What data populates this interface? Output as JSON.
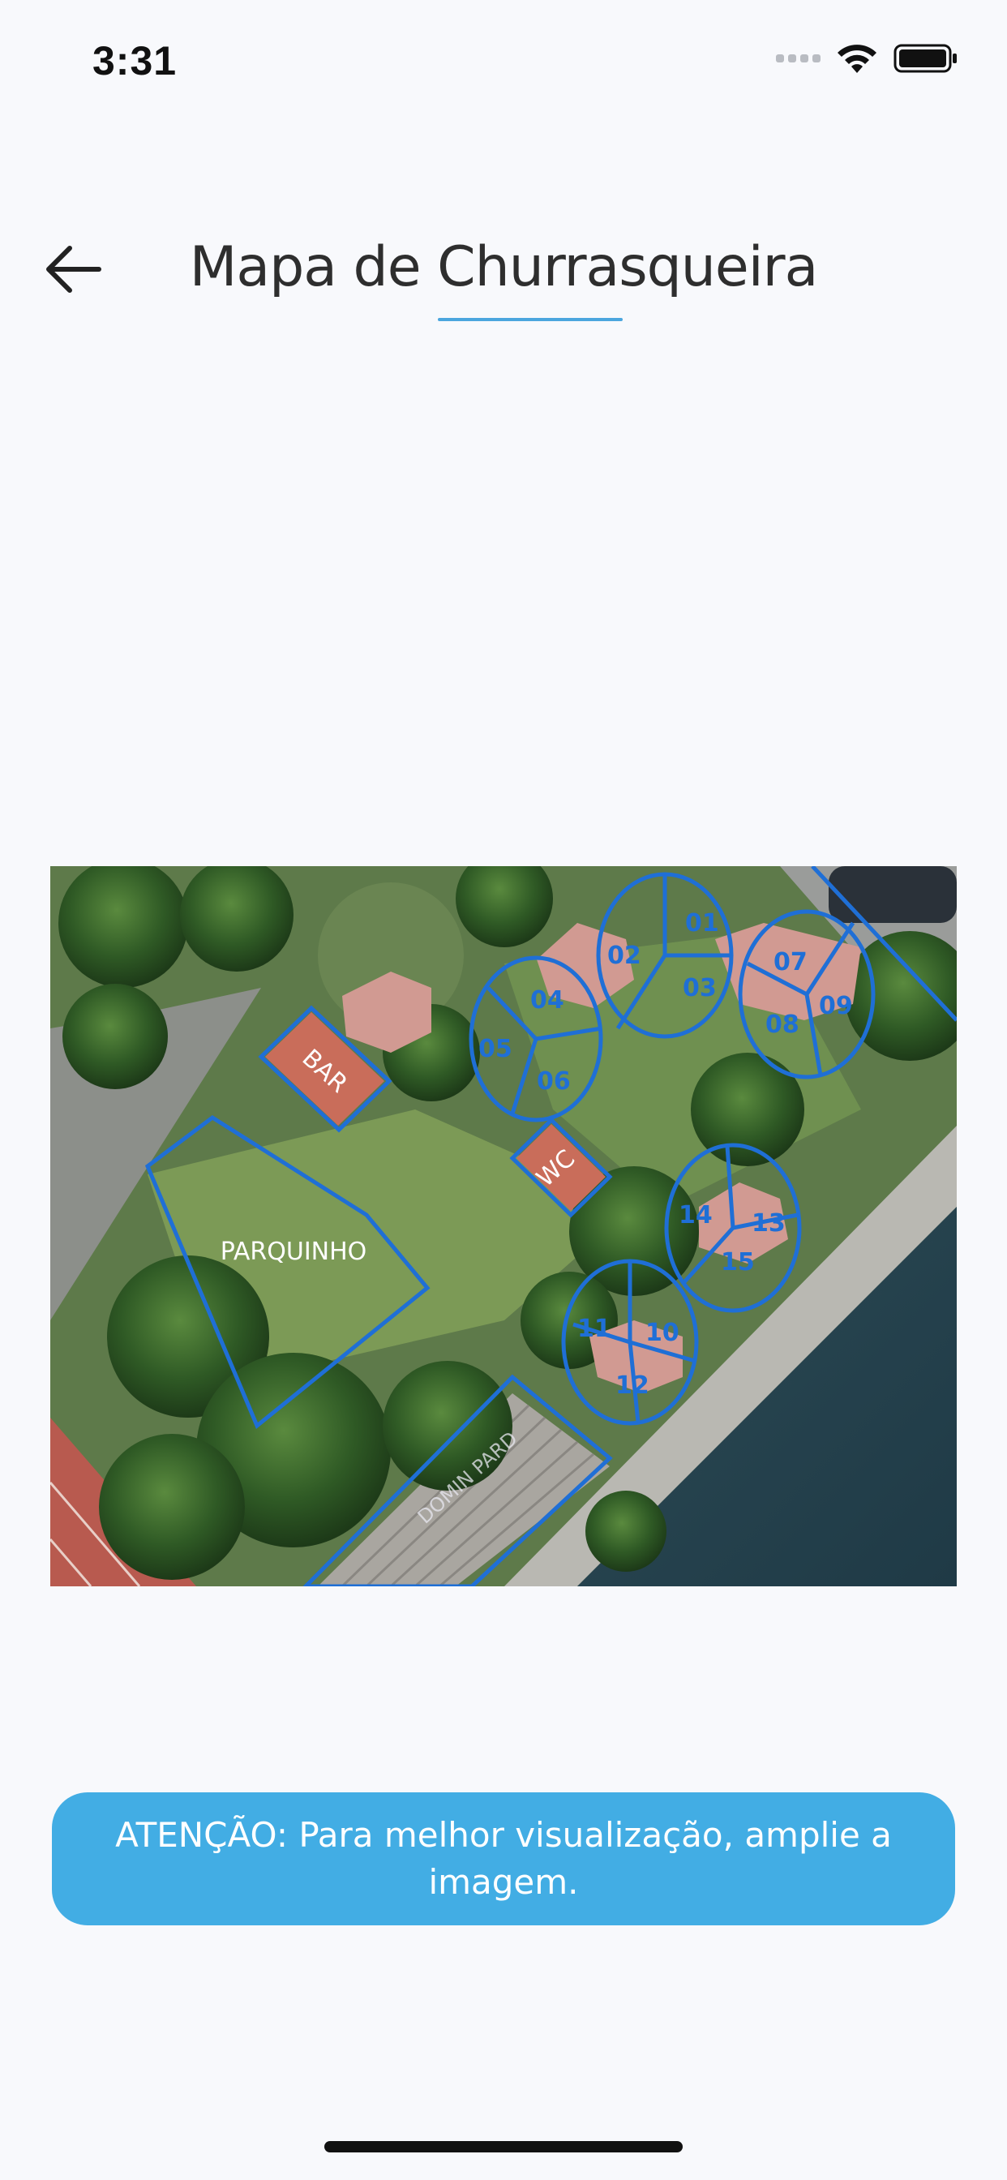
{
  "status_bar": {
    "time": "3:31",
    "icons": [
      "signal-icon",
      "wifi-icon",
      "battery-icon"
    ]
  },
  "header": {
    "back_icon": "arrow-left-icon",
    "title": "Mapa de Churrasqueira",
    "accent_color": "#4ba6de"
  },
  "map": {
    "labels": {
      "bar": "BAR",
      "wc": "WC",
      "parquinho": "PARQUINHO",
      "bottom_area": "DOMIN PARD"
    },
    "spots": [
      "01",
      "02",
      "03",
      "04",
      "05",
      "06",
      "07",
      "08",
      "09",
      "10",
      "11",
      "12",
      "13",
      "14",
      "15"
    ],
    "line_color": "#1f6fd6"
  },
  "notice": {
    "text": "ATENÇÃO: Para melhor visualização, amplie a imagem.",
    "background_color": "#42ade4"
  }
}
